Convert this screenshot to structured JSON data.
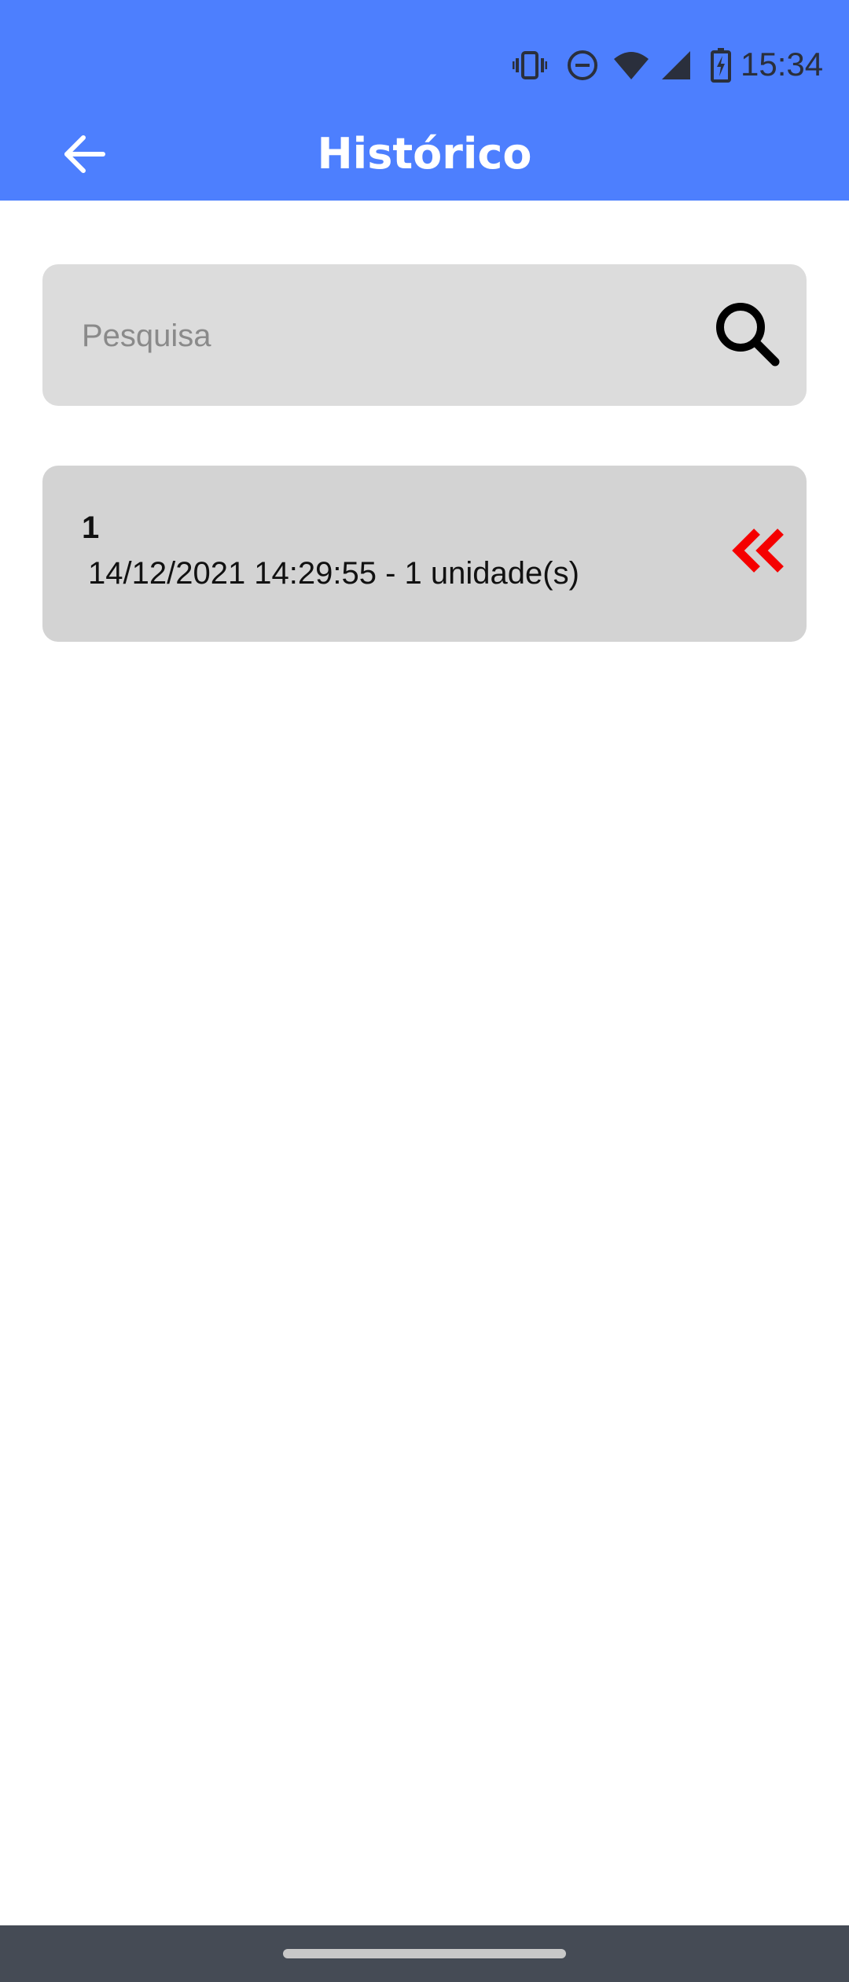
{
  "status_bar": {
    "time": "15:34",
    "icons": [
      "vibrate-icon",
      "do-not-disturb-icon",
      "wifi-icon",
      "cell-signal-icon",
      "battery-charging-icon"
    ]
  },
  "header": {
    "title": "Histórico",
    "back_icon": "arrow-left-icon",
    "background_color": "#4d7ffe"
  },
  "search": {
    "placeholder": "Pesquisa",
    "value": "",
    "icon": "search-icon"
  },
  "history": {
    "items": [
      {
        "id": "1",
        "detail": "14/12/2021 14:29:55 - 1 unidade(s)",
        "action_icon": "double-chevron-left-icon",
        "action_color": "#f50000"
      }
    ]
  },
  "nav_bar": {
    "background_color": "#454b55"
  }
}
